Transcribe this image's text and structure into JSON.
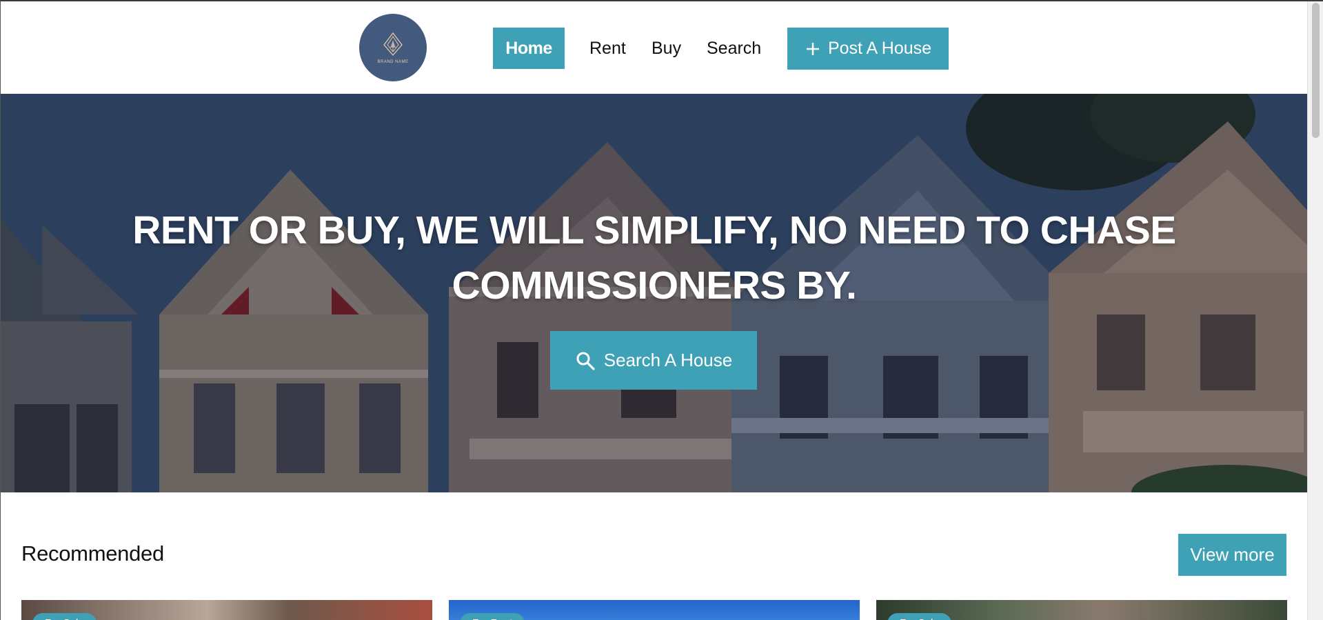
{
  "header": {
    "logo_text": "BRAND NAME",
    "nav": {
      "home": "Home",
      "rent": "Rent",
      "buy": "Buy",
      "search": "Search"
    },
    "post_button": "Post A House",
    "post_icon": "plus-icon"
  },
  "hero": {
    "title": "RENT OR BUY, WE WILL SIMPLIFY, NO NEED TO CHASE COMMISSIONERS BY.",
    "button_label": "Search A House",
    "button_icon": "search-icon"
  },
  "recommended": {
    "title": "Recommended",
    "view_more": "View more",
    "cards": [
      {
        "badge": "For Sale"
      },
      {
        "badge": "For Rent"
      },
      {
        "badge": "For Sale"
      }
    ]
  },
  "colors": {
    "accent": "#3fa1b5",
    "logo_bg": "#435a7e",
    "logo_text": "#e7c9a8",
    "text": "#111111",
    "background": "#ffffff"
  }
}
